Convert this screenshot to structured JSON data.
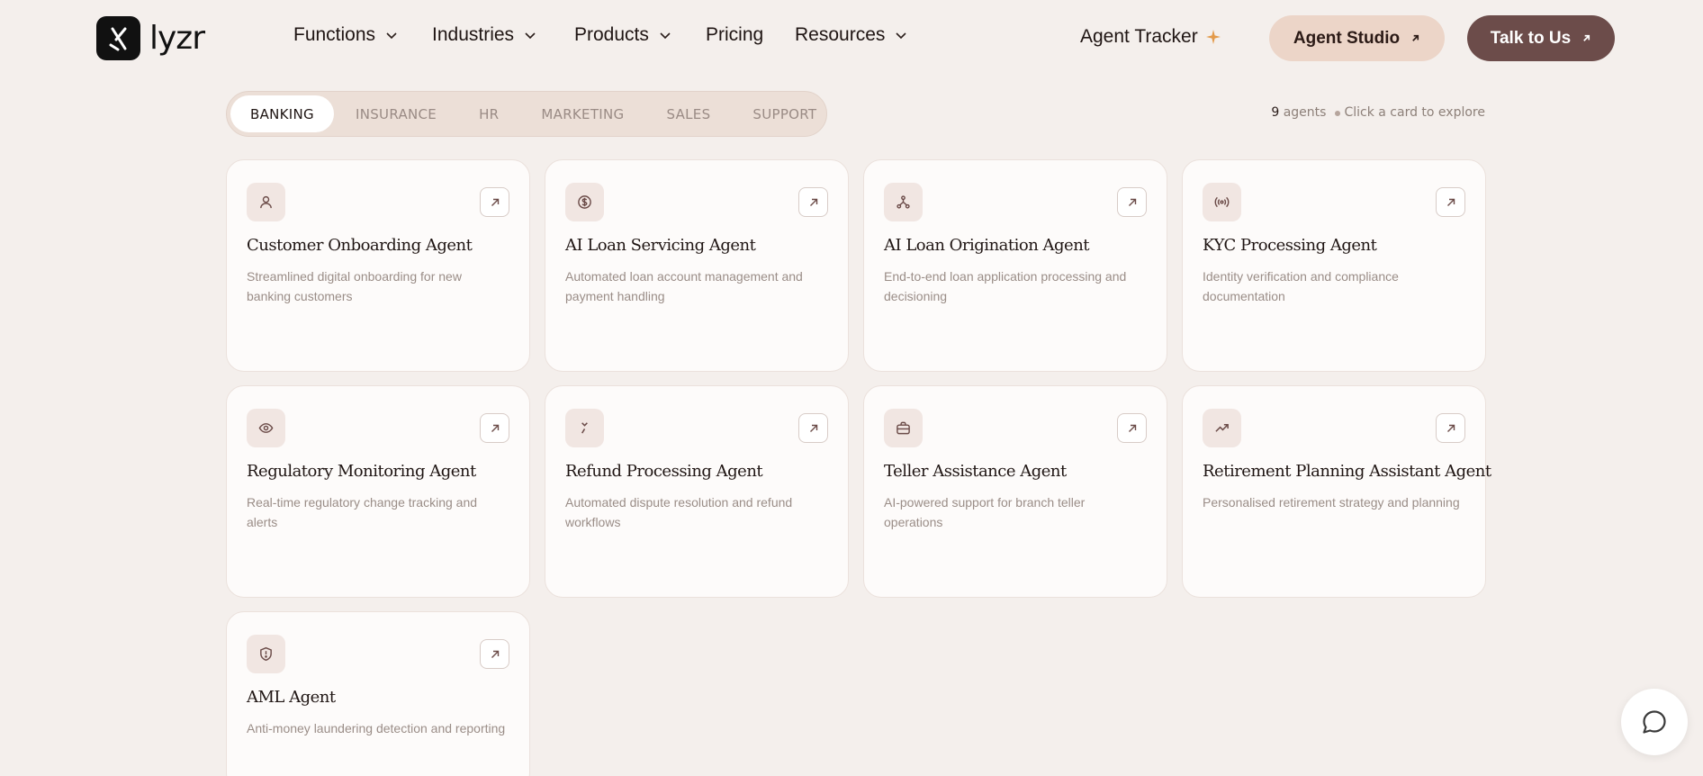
{
  "nav": {
    "logo_text": "lyzr",
    "items": [
      {
        "label": "Functions"
      },
      {
        "label": "Industries"
      },
      {
        "label": "Products"
      },
      {
        "label": "Pricing"
      },
      {
        "label": "Resources"
      }
    ],
    "tracker_label": "Agent Tracker",
    "studio_label": "Agent Studio",
    "talk_label": "Talk to Us"
  },
  "tabs": [
    "BANKING",
    "INSURANCE",
    "HR",
    "MARKETING",
    "SALES",
    "SUPPORT"
  ],
  "active_tab": "BANKING",
  "meta": {
    "count": "9",
    "count_label": "agents",
    "hint": "Click a card to explore"
  },
  "cards": [
    {
      "title": "Customer Onboarding Agent",
      "desc": "Streamlined digital onboarding for new banking customers",
      "icon": "user-icon"
    },
    {
      "title": "AI Loan Servicing Agent",
      "desc": "Automated loan account management and payment handling",
      "icon": "dollar-coin-icon"
    },
    {
      "title": "AI Loan Origination Agent",
      "desc": "End-to-end loan application processing and decisioning",
      "icon": "workflow-icon"
    },
    {
      "title": "KYC Processing Agent",
      "desc": "Identity verification and compliance documentation",
      "icon": "broadcast-icon"
    },
    {
      "title": "Regulatory Monitoring Agent",
      "desc": "Real-time regulatory change tracking and alerts",
      "icon": "eye-icon"
    },
    {
      "title": "Refund Processing Agent",
      "desc": "Automated dispute resolution and refund workflows",
      "icon": "refund-icon"
    },
    {
      "title": "Teller Assistance Agent",
      "desc": "AI-powered support for branch teller operations",
      "icon": "briefcase-icon"
    },
    {
      "title": "Retirement Planning Assistant Agent",
      "desc": "Personalised retirement strategy and planning",
      "icon": "trending-up-icon"
    },
    {
      "title": "AML Agent",
      "desc": "Anti-money laundering detection and reporting",
      "icon": "shield-alert-icon"
    }
  ],
  "colors": {
    "background": "#f4efec",
    "studio_button": "#ecd5c8",
    "talk_button": "#6c4c4a",
    "tracker_sparkle": "#e39a4a"
  }
}
